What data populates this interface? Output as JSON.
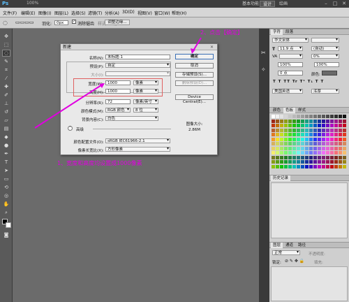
{
  "app": {
    "logo": "Ps",
    "zoom": "100%"
  },
  "workspaces": [
    "基本功能",
    "设计",
    "绘画"
  ],
  "active_workspace": "基本功能",
  "menu": [
    "文件(F)",
    "编辑(E)",
    "图像(I)",
    "图层(L)",
    "选择(S)",
    "滤镜(T)",
    "分析(A)",
    "3D(D)",
    "视图(V)",
    "窗口(W)",
    "帮助(H)"
  ],
  "options": {
    "feather_label": "羽化:",
    "feather_value": "0px",
    "antialias": "消除锯齿",
    "style_label": "样式:",
    "style_value": "正常",
    "refine_edge": "调整边缘..."
  },
  "dialog": {
    "title": "新建",
    "name_label": "名称(N):",
    "name_value": "未标题-1",
    "preset_label": "预设(P):",
    "preset_value": "自定",
    "size_label": "大小(I):",
    "width_label": "宽度(W):",
    "width_value": "1000",
    "width_unit": "像素",
    "height_label": "高度(H):",
    "height_value": "1000",
    "height_unit": "像素",
    "resolution_label": "分辨率(R):",
    "resolution_value": "72",
    "resolution_unit": "像素/英寸",
    "mode_label": "颜色模式(M):",
    "mode_value": "RGB 颜色",
    "bits_value": "8 位",
    "bg_label": "背景内容(C):",
    "bg_value": "白色",
    "advanced_label": "高级",
    "profile_label": "颜色配置文件(O):",
    "profile_value": "sRGB IEC61966-2.1",
    "aspect_label": "像素长宽比(X):",
    "aspect_value": "方形像素",
    "ok": "确定",
    "cancel": "取消",
    "save_preset": "存储预设(S)...",
    "delete_preset": "删除预设(D)...",
    "device_central": "Device Central(E)...",
    "image_size_label": "图像大小:",
    "image_size_value": "2.86M"
  },
  "annotations": {
    "step1": "1、宽度和高度均设置成1000像素",
    "step2": "2、点击【确定】"
  },
  "panels": {
    "char_tabs": [
      "字符",
      "段落"
    ],
    "font": "华文宋体",
    "font_size": "11.9 点",
    "leading": "(自动)",
    "scale_v": "100%",
    "scale_h": "100%",
    "tracking": "0%",
    "baseline": "0 点",
    "color_label": "颜色:",
    "lang": "美国英语",
    "aa": "浑厚",
    "swatch_tabs": [
      "颜色",
      "色板",
      "样式"
    ],
    "history_tabs": [
      "历史记录"
    ],
    "layer_tabs": [
      "图层",
      "通道",
      "路径"
    ],
    "blend": "正常",
    "opacity_label": "不透明度:",
    "lock_label": "锁定:",
    "fill_label": "填充:"
  },
  "colors": {
    "annotation": "#e000e0",
    "accent": "#d00000"
  }
}
